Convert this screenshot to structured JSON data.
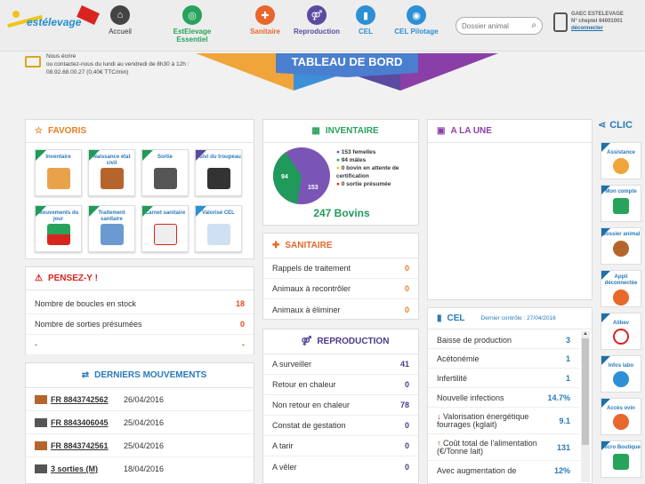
{
  "header": {
    "logo": "estélevage",
    "nav": [
      {
        "label": "Accueil",
        "icon": "home-icon",
        "color": "#444"
      },
      {
        "label": "EstElevage Essentiel",
        "icon": "compass-icon",
        "color": "#27a35b"
      },
      {
        "label": "Sanitaire",
        "icon": "medical-cross-icon",
        "color": "#e8672b"
      },
      {
        "label": "Reproduction",
        "icon": "reproduction-icon",
        "color": "#5b4aa0"
      },
      {
        "label": "CEL",
        "icon": "bottle-icon",
        "color": "#2d8fd6"
      },
      {
        "label": "CEL Pilotage",
        "icon": "gauge-icon",
        "color": "#2d8fd6"
      }
    ],
    "search_placeholder": "Dossier animal",
    "user": {
      "name": "GAEC ESTELEVAGE",
      "cheptel": "N° cheptel 64001001",
      "logout": "déconnecter"
    }
  },
  "contact": {
    "line1": "Nous écrire",
    "line2": "ou contactez-nous du lundi au vendredi de 8h30 à 12h :",
    "line3": "08.92.68.00.27 (0,40€ TTC/min)"
  },
  "title": "TABLEAU DE BORD",
  "favoris": {
    "title": "FAVORIS",
    "tiles": [
      "Inventaire",
      "Naissance état civil",
      "Sortie",
      "Suivi du troupeau",
      "Mouvements du jour",
      "Traitement sanitaire",
      "Carnet sanitaire",
      "Valorisé CEL"
    ]
  },
  "pensez": {
    "title": "PENSEZ-Y !",
    "rows": [
      {
        "label": "Nombre de boucles en stock",
        "value": "18"
      },
      {
        "label": "Nombre de sorties présumées",
        "value": "0"
      },
      {
        "label": "-",
        "value": "-"
      }
    ]
  },
  "mouvements": {
    "title": "DERNIERS MOUVEMENTS",
    "rows": [
      {
        "id": "FR 8843742562",
        "date": "26/04/2016"
      },
      {
        "id": "FR 8843406045",
        "date": "25/04/2016"
      },
      {
        "id": "FR 8843742561",
        "date": "25/04/2016"
      },
      {
        "id": "3 sorties (M)",
        "date": "18/04/2016"
      }
    ]
  },
  "inventaire": {
    "title": "INVENTAIRE",
    "total": "247 Bovins",
    "legend": [
      "153 femelles",
      "94 mâles",
      "0 bovin en attente de certification",
      "0 sortie présumée"
    ],
    "pie": {
      "femelles": 153,
      "males": 94
    }
  },
  "sanitaire": {
    "title": "SANITAIRE",
    "rows": [
      {
        "label": "Rappels de traitement",
        "value": "0"
      },
      {
        "label": "Animaux à recontrôler",
        "value": "0"
      },
      {
        "label": "Animaux à éliminer",
        "value": "0"
      }
    ]
  },
  "reproduction": {
    "title": "REPRODUCTION",
    "rows": [
      {
        "label": "A surveiller",
        "value": "41"
      },
      {
        "label": "Retour en chaleur",
        "value": "0"
      },
      {
        "label": "Non retour en chaleur",
        "value": "78"
      },
      {
        "label": "Constat de gestation",
        "value": "0"
      },
      {
        "label": "A tarir",
        "value": "0"
      },
      {
        "label": "A vêler",
        "value": "0"
      }
    ]
  },
  "alaune": {
    "title": "A LA UNE"
  },
  "cel": {
    "title": "CEL",
    "control": "Dernier contrôle : 27/04/2016",
    "rows": [
      {
        "label": "Baisse de production",
        "value": "3"
      },
      {
        "label": "Acétonémie",
        "value": "1"
      },
      {
        "label": "Infertilité",
        "value": "1"
      },
      {
        "label": "Nouvelle infections",
        "value": "14.7%"
      },
      {
        "label": "Valorisation énergétique fourrages (kglait)",
        "value": "9.1"
      },
      {
        "label": "Coût total de l'alimentation (€/Tonne lait)",
        "value": "131"
      },
      {
        "label": "Avec augmentation de",
        "value": "12%"
      }
    ]
  },
  "clic": {
    "title": "CLIC",
    "items": [
      "Assistance",
      "Mon compte",
      "Dossier animal",
      "Appli déconnectée",
      "Alibev",
      "Infos labo",
      "Accès ovin",
      "Micro Boutique"
    ]
  }
}
